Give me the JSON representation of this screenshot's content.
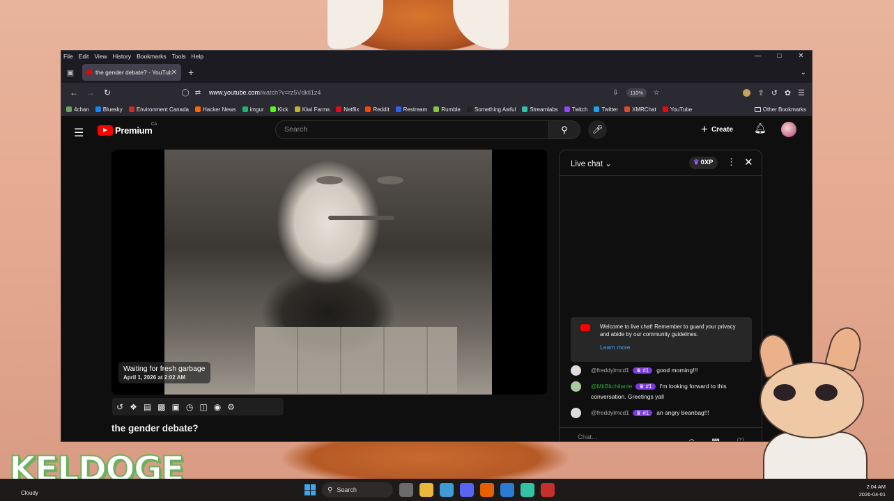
{
  "browser": {
    "menu": [
      "File",
      "Edit",
      "View",
      "History",
      "Bookmarks",
      "Tools",
      "Help"
    ],
    "tab_title": "the gender debate? - YouTube",
    "url_host": "www.youtube.com",
    "url_path": "/watch?v=rz5Vdkll1z4",
    "zoom": "110%",
    "bookmarks": [
      {
        "label": "4chan",
        "color": "#6ba35d"
      },
      {
        "label": "Bluesky",
        "color": "#1185fe"
      },
      {
        "label": "Environment Canada",
        "color": "#d52b1e"
      },
      {
        "label": "Hacker News",
        "color": "#ff6600"
      },
      {
        "label": "imgur",
        "color": "#1bb76e"
      },
      {
        "label": "Kick",
        "color": "#53fc18"
      },
      {
        "label": "Kiwi Farms",
        "color": "#c7b12c"
      },
      {
        "label": "Netflix",
        "color": "#e50914"
      },
      {
        "label": "Reddit",
        "color": "#ff4500"
      },
      {
        "label": "Restream",
        "color": "#2e62f5"
      },
      {
        "label": "Rumble",
        "color": "#85c742"
      },
      {
        "label": "Something Awful",
        "color": "#222222"
      },
      {
        "label": "Streamlabs",
        "color": "#31c3a2"
      },
      {
        "label": "Twitch",
        "color": "#9146ff"
      },
      {
        "label": "Twitter",
        "color": "#1da1f2"
      },
      {
        "label": "XMRChat",
        "color": "#e24a2a"
      },
      {
        "label": "YouTube",
        "color": "#ff0000"
      }
    ],
    "other_bookmarks": "Other Bookmarks"
  },
  "youtube": {
    "logo_text": "Premium",
    "country": "CA",
    "search_placeholder": "Search",
    "create_label": "Create",
    "video": {
      "overlay_title": "Waiting for fresh garbage",
      "overlay_date": "April 1, 2026 at 2:02 AM",
      "title": "the gender debate?"
    },
    "chat": {
      "title": "Live chat",
      "xp": "0XP",
      "welcome": "Welcome to live chat! Remember to guard your privacy and abide by our community guidelines.",
      "learn_more": "Learn more",
      "messages": [
        {
          "author": "@freddylmcd1",
          "rank": "#1",
          "text": "good morning!!!"
        },
        {
          "author": "@MkBitchilante",
          "rank": "#1",
          "text": "I'm looking forward to this conversation. Greetings yall"
        },
        {
          "author": "@freddylmcd1",
          "rank": "#1",
          "text": "an angry beanbag!!!"
        }
      ],
      "input_placeholder": "Chat..."
    }
  },
  "overlay": {
    "streamer_name": "KELDOGE"
  },
  "taskbar": {
    "weather": "Cloudy",
    "search": "Search",
    "time": "2:04 AM",
    "date": "2026-04-01"
  }
}
